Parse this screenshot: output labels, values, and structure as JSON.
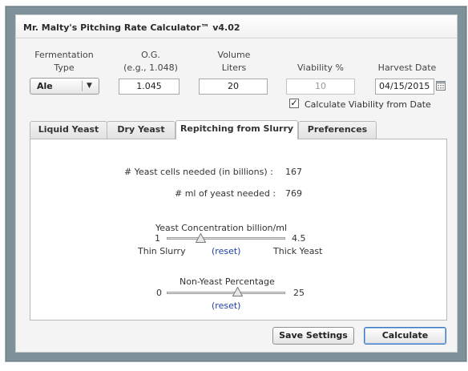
{
  "window": {
    "title": "Mr. Malty's Pitching Rate Calculator™ v4.02"
  },
  "inputs": {
    "fermentation": {
      "label1": "Fermentation",
      "label2": "Type",
      "value": "Ale"
    },
    "og": {
      "label1": "O.G.",
      "label2": "(e.g., 1.048)",
      "value": "1.045"
    },
    "volume": {
      "label1": "Volume",
      "label2": "Liters",
      "value": "20"
    },
    "viability": {
      "label": "Viability %",
      "value": "10"
    },
    "harvest": {
      "label": "Harvest Date",
      "value": "04/15/2015"
    },
    "calc_viability": {
      "label": "Calculate Viability from Date",
      "checked": true
    }
  },
  "tabs": [
    {
      "label": "Liquid Yeast",
      "active": false
    },
    {
      "label": "Dry Yeast",
      "active": false
    },
    {
      "label": "Repitching from Slurry",
      "active": true
    },
    {
      "label": "Preferences",
      "active": false
    }
  ],
  "results": {
    "cells_label": "# Yeast cells needed (in billions) :",
    "cells_value": "167",
    "ml_label": "# ml of yeast needed :",
    "ml_value": "769"
  },
  "concentration": {
    "label": "Yeast Concentration billion/ml",
    "min": "1",
    "max": "4.5",
    "left_caption": "Thin Slurry",
    "right_caption": "Thick Yeast",
    "reset": "(reset)",
    "value": 2.0
  },
  "non_yeast": {
    "label": "Non-Yeast Percentage",
    "min": "0",
    "max": "25",
    "reset": "(reset)",
    "value": 15
  },
  "buttons": {
    "save": "Save Settings",
    "calculate": "Calculate"
  },
  "icons": {
    "dropdown": "chevron-down-icon",
    "calendar": "calendar-icon",
    "check": "checkmark-icon"
  },
  "colors": {
    "link": "#1f3fa8",
    "primary_border": "#3b78c2",
    "frame": "#7f929c"
  }
}
